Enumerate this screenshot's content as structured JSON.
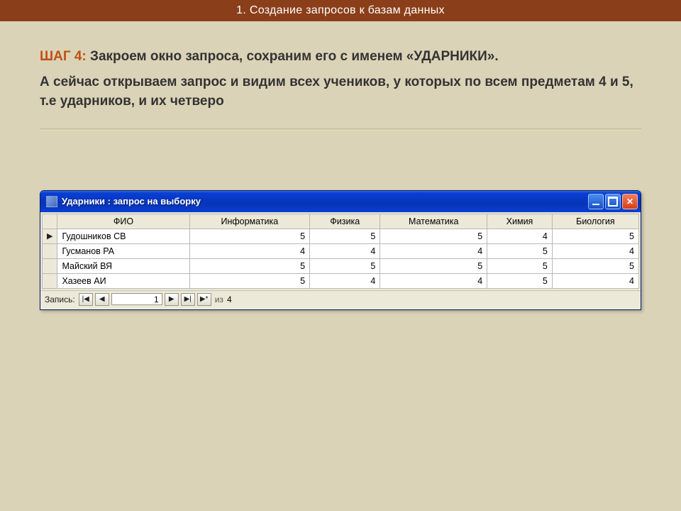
{
  "slide": {
    "header": "1. Создание запросов к базам данных",
    "step_label": "ШАГ 4:",
    "step_text": "Закроем окно запроса, сохраним его с именем «УДАРНИКИ».",
    "para2": "А сейчас открываем запрос и видим всех учеников, у которых по всем предметам 4 и 5, т.е ударников, и их четверо"
  },
  "window": {
    "title": "Ударники : запрос на выборку"
  },
  "table": {
    "columns": [
      "ФИО",
      "Информатика",
      "Физика",
      "Математика",
      "Химия",
      "Биология"
    ],
    "rows": [
      {
        "marker": "▶",
        "fio": "Гудошников СВ",
        "vals": [
          5,
          5,
          5,
          4,
          5
        ]
      },
      {
        "marker": "",
        "fio": "Гусманов РА",
        "vals": [
          4,
          4,
          4,
          5,
          4
        ]
      },
      {
        "marker": "",
        "fio": "Майский ВЯ",
        "vals": [
          5,
          5,
          5,
          5,
          5
        ]
      },
      {
        "marker": "",
        "fio": "Хазеев АИ",
        "vals": [
          5,
          4,
          4,
          5,
          4
        ]
      }
    ]
  },
  "nav": {
    "label": "Запись:",
    "current": "1",
    "of_label": "из",
    "total": "4",
    "first": "|◀",
    "prev": "◀",
    "next": "▶",
    "last": "▶|",
    "new": "▶*"
  }
}
